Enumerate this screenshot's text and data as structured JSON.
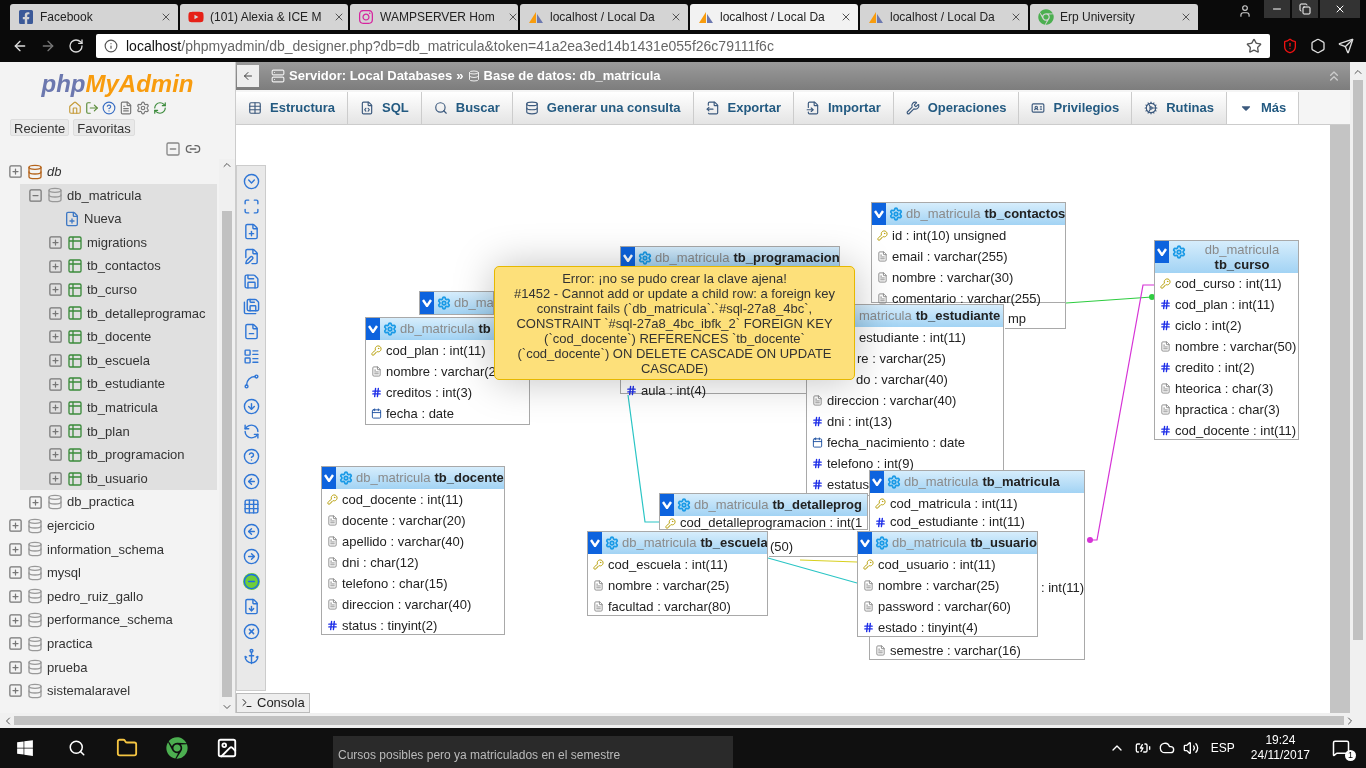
{
  "browser": {
    "tabs": [
      {
        "title": "Facebook",
        "kind": "facebook",
        "selected": false
      },
      {
        "title": "(101) Alexia & ICE M",
        "kind": "youtube",
        "selected": false
      },
      {
        "title": "WAMPSERVER Hom",
        "kind": "instagram",
        "selected": false
      },
      {
        "title": "localhost / Local Da",
        "kind": "pma",
        "selected": false
      },
      {
        "title": "localhost / Local Da",
        "kind": "pma",
        "selected": true
      },
      {
        "title": "localhost / Local Da",
        "kind": "pma",
        "selected": false
      },
      {
        "title": "Erp University",
        "kind": "chrome",
        "selected": false
      }
    ],
    "address": {
      "host": "localhost",
      "path": "/phpmyadmin/db_designer.php?db=db_matricula&token=41a2ea3ed14b1431e055f26c79111f6c"
    }
  },
  "sidebar": {
    "logo": {
      "prefix": "php",
      "main": "MyAdmin"
    },
    "buttons": [
      "Reciente",
      "Favoritas"
    ],
    "tree": [
      {
        "label": "db",
        "kind": "group",
        "expanded": false,
        "children": [
          {
            "label": "db_matricula",
            "kind": "database",
            "expanded": true,
            "children": [
              {
                "label": "Nueva",
                "kind": "new"
              },
              {
                "label": "migrations",
                "kind": "table",
                "expanded": false
              },
              {
                "label": "tb_contactos",
                "kind": "table",
                "expanded": false
              },
              {
                "label": "tb_curso",
                "kind": "table",
                "expanded": false
              },
              {
                "label": "tb_detalleprogramac",
                "kind": "table",
                "expanded": false
              },
              {
                "label": "tb_docente",
                "kind": "table",
                "expanded": false
              },
              {
                "label": "tb_escuela",
                "kind": "table",
                "expanded": false
              },
              {
                "label": "tb_estudiante",
                "kind": "table",
                "expanded": false
              },
              {
                "label": "tb_matricula",
                "kind": "table",
                "expanded": false
              },
              {
                "label": "tb_plan",
                "kind": "table",
                "expanded": false
              },
              {
                "label": "tb_programacion",
                "kind": "table",
                "expanded": false
              },
              {
                "label": "tb_usuario",
                "kind": "table",
                "expanded": false
              }
            ]
          },
          {
            "label": "db_practica",
            "kind": "database",
            "expanded": false
          }
        ]
      },
      {
        "label": "ejercicio",
        "kind": "database",
        "expanded": false
      },
      {
        "label": "information_schema",
        "kind": "database",
        "expanded": false
      },
      {
        "label": "mysql",
        "kind": "database",
        "expanded": false
      },
      {
        "label": "pedro_ruiz_gallo",
        "kind": "database",
        "expanded": false
      },
      {
        "label": "performance_schema",
        "kind": "database",
        "expanded": false
      },
      {
        "label": "practica",
        "kind": "database",
        "expanded": false
      },
      {
        "label": "prueba",
        "kind": "database",
        "expanded": false
      },
      {
        "label": "sistemalaravel",
        "kind": "database",
        "expanded": false
      }
    ]
  },
  "breadcrumb": {
    "server": "Servidor: Local Databases",
    "separator": "»",
    "database": "Base de datos: db_matricula"
  },
  "tabs": [
    {
      "label": "Estructura",
      "selected": false
    },
    {
      "label": "SQL",
      "selected": false
    },
    {
      "label": "Buscar",
      "selected": false
    },
    {
      "label": "Generar una consulta",
      "selected": false
    },
    {
      "label": "Exportar",
      "selected": false
    },
    {
      "label": "Importar",
      "selected": false
    },
    {
      "label": "Operaciones",
      "selected": false
    },
    {
      "label": "Privilegios",
      "selected": false
    },
    {
      "label": "Rutinas",
      "selected": false
    },
    {
      "label": "Más",
      "selected": true
    }
  ],
  "designer": {
    "tables": [
      {
        "db": "db_matricula",
        "name": "tb_programacion",
        "rows": [
          {
            "kind": "number",
            "text": "aula : int(4)"
          }
        ]
      },
      {
        "db": "db_matricula",
        "name": "tb_contactos",
        "rows": [
          {
            "kind": "key",
            "text": "id : int(10) unsigned"
          },
          {
            "kind": "text",
            "text": "email : varchar(255)"
          },
          {
            "kind": "text",
            "text": "nombre : varchar(30)"
          },
          {
            "kind": "text",
            "text": "comentario : varchar(255)"
          },
          {
            "kind": "cut",
            "text": "mp"
          }
        ]
      },
      {
        "db": "db_matricula",
        "name": "tb_curso",
        "rows": [
          {
            "kind": "key",
            "text": "cod_curso : int(11)"
          },
          {
            "kind": "number",
            "text": "cod_plan : int(11)"
          },
          {
            "kind": "number",
            "text": "ciclo : int(2)"
          },
          {
            "kind": "text",
            "text": "nombre : varchar(50)"
          },
          {
            "kind": "number",
            "text": "credito : int(2)"
          },
          {
            "kind": "text",
            "text": "hteorica : char(3)"
          },
          {
            "kind": "text",
            "text": "hpractica : char(3)"
          },
          {
            "kind": "number",
            "text": "cod_docente : int(11)"
          }
        ]
      },
      {
        "db": "db_ma"
      },
      {
        "db": "db_matricula",
        "name": "tb",
        "rows": [
          {
            "kind": "key",
            "text": "cod_plan : int(11)"
          },
          {
            "kind": "text",
            "text": "nombre : varchar(2"
          },
          {
            "kind": "number",
            "text": "creditos : int(3)"
          },
          {
            "kind": "date",
            "text": "fecha : date"
          }
        ]
      },
      {
        "db": "matricula",
        "name": "tb_estudiante",
        "rows": [
          {
            "kind": "cut",
            "text": "estudiante : int(11)"
          },
          {
            "kind": "cut",
            "text": "re : varchar(25)"
          },
          {
            "kind": "cut",
            "text": "do : varchar(40)"
          },
          {
            "kind": "text",
            "text": "direccion : varchar(40)"
          },
          {
            "kind": "number",
            "text": "dni : int(13)"
          },
          {
            "kind": "date",
            "text": "fecha_nacimiento : date"
          },
          {
            "kind": "number",
            "text": "telefono : int(9)"
          },
          {
            "kind": "number",
            "text": "estatus"
          }
        ]
      },
      {
        "db": "db_matricula",
        "name": "tb_docente",
        "rows": [
          {
            "kind": "key",
            "text": "cod_docente : int(11)"
          },
          {
            "kind": "text",
            "text": "docente : varchar(20)"
          },
          {
            "kind": "text",
            "text": "apellido : varchar(40)"
          },
          {
            "kind": "text",
            "text": "dni : char(12)"
          },
          {
            "kind": "text",
            "text": "telefono : char(15)"
          },
          {
            "kind": "text",
            "text": "direccion : varchar(40)"
          },
          {
            "kind": "number",
            "text": "status : tinyint(2)"
          }
        ]
      },
      {
        "db": "db_matricula",
        "name": "tb_escuela",
        "rows": [
          {
            "kind": "key",
            "text": "cod_escuela : int(11)"
          },
          {
            "kind": "text",
            "text": "nombre : varchar(25)"
          },
          {
            "kind": "text",
            "text": "facultad : varchar(80)"
          }
        ]
      },
      {
        "db": "db_matricula",
        "name": "tb_detalleprog",
        "rows": [
          {
            "kind": "key",
            "text": "cod_detalleprogramacion : int(1"
          },
          {
            "kind": "cut",
            "text": "(50)"
          }
        ]
      },
      {
        "db": "db_matricula",
        "name": "tb_matricula",
        "rows": [
          {
            "kind": "key",
            "text": "cod_matricula : int(11)"
          },
          {
            "kind": "number",
            "text": "cod_estudiante : int(11)"
          },
          {
            "kind": "cut",
            "text": ": int(11)"
          },
          {
            "kind": "text",
            "text": "semestre : varchar(16)"
          }
        ]
      },
      {
        "db": "db_matricula",
        "name": "tb_usuario",
        "rows": [
          {
            "kind": "key",
            "text": "cod_usuario : int(11)"
          },
          {
            "kind": "text",
            "text": "nombre : varchar(25)"
          },
          {
            "kind": "text",
            "text": "password : varchar(60)"
          },
          {
            "kind": "number",
            "text": "estado : tinyint(4)"
          }
        ]
      }
    ],
    "error": {
      "title": "Error: ¡no se pudo crear la clave ajena!",
      "message": "#1452 - Cannot add or update a child row: a foreign key constraint fails (`db_matricula`.`#sql-27a8_4bc`, CONSTRAINT `#sql-27a8_4bc_ibfk_2` FOREIGN KEY (`cod_docente`) REFERENCES `tb_docente` (`cod_docente`) ON DELETE CASCADE ON UPDATE CASCADE)"
    }
  },
  "console": {
    "label": "Consola"
  },
  "taskbar": {
    "peek_text": "Cursos posibles pero ya matriculados en el semestre",
    "language": "ESP",
    "time": "19:24",
    "date": "24/11/2017",
    "notifications": "1"
  }
}
